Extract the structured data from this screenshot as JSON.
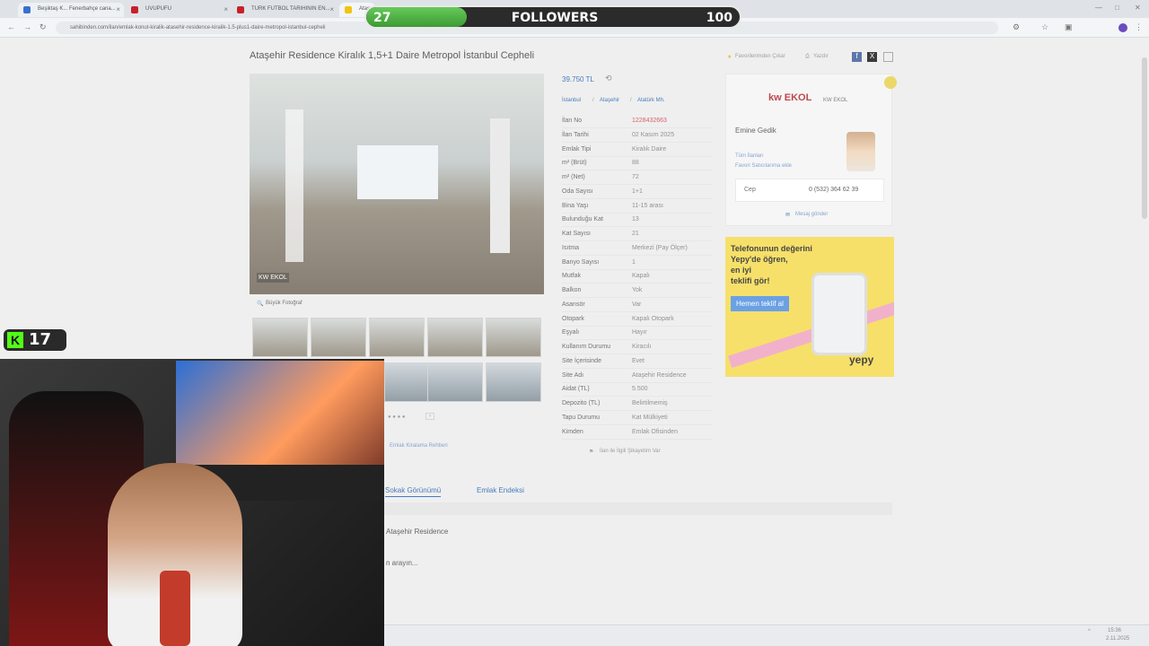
{
  "browser": {
    "tabs": [
      {
        "label": "Beşiktaş K... Fenerbahçe cana...",
        "color": "#3b6fd1"
      },
      {
        "label": "UVUPUFU",
        "color": "#c8202b"
      },
      {
        "label": "TURK FUTBOL TARIHININ EN...",
        "color": "#c8202b"
      },
      {
        "label": "Ataş...",
        "color": "#f1c40f"
      }
    ],
    "url": "sahibinden.com/ilan/emlak-konut-kiralik-atasehir-residence-kiralik-1.5-plus1-daire-metropol-istanbul-cepheli"
  },
  "overlay": {
    "followers_current": "27",
    "followers_label": "FOLLOWERS",
    "followers_goal": "100",
    "followers_progress": 0.27,
    "kick_count": "17"
  },
  "listing": {
    "title": "Ataşehir Residence Kiralık 1,5+1 Daire Metropol İstanbul Cepheli",
    "price": "39.750 TL",
    "location": [
      "İstanbul",
      "Ataşehir",
      "Atatürk Mh."
    ],
    "big_photo": "Büyük Fotoğraf",
    "photo_watermark": "KW EKOL",
    "guide_link": "Emlak Kiralama Rehberi",
    "complaint_link": "İlan ile İlgili Şikayetim Var",
    "details": [
      {
        "k": "İlan No",
        "v": "1228432663"
      },
      {
        "k": "İlan Tarihi",
        "v": "02 Kasım 2025"
      },
      {
        "k": "Emlak Tipi",
        "v": "Kiralık Daire"
      },
      {
        "k": "m² (Brüt)",
        "v": "88"
      },
      {
        "k": "m² (Net)",
        "v": "72"
      },
      {
        "k": "Oda Sayısı",
        "v": "1+1"
      },
      {
        "k": "Bina Yaşı",
        "v": "11-15 arası"
      },
      {
        "k": "Bulunduğu Kat",
        "v": "13"
      },
      {
        "k": "Kat Sayısı",
        "v": "21"
      },
      {
        "k": "Isıtma",
        "v": "Merkezi (Pay Ölçer)"
      },
      {
        "k": "Banyo Sayısı",
        "v": "1"
      },
      {
        "k": "Mutfak",
        "v": "Kapalı"
      },
      {
        "k": "Balkon",
        "v": "Yok"
      },
      {
        "k": "Asansör",
        "v": "Var"
      },
      {
        "k": "Otopark",
        "v": "Kapalı Otopark"
      },
      {
        "k": "Eşyalı",
        "v": "Hayır"
      },
      {
        "k": "Kullanım Durumu",
        "v": "Kiracılı"
      },
      {
        "k": "Site İçerisinde",
        "v": "Evet"
      },
      {
        "k": "Site Adı",
        "v": "Ataşehir Residence"
      },
      {
        "k": "Aidat (TL)",
        "v": "5.500"
      },
      {
        "k": "Depozito (TL)",
        "v": "Belirtilmemiş"
      },
      {
        "k": "Tapu Durumu",
        "v": "Kat Mülkiyeti"
      },
      {
        "k": "Kimden",
        "v": "Emlak Ofisinden"
      }
    ],
    "tabs": [
      "Sokak Görünümü",
      "Emlak Endeksi"
    ],
    "lower_text": "Ataşehir Residence",
    "lower_text2": "n arayın..."
  },
  "top_actions": {
    "favorites": "Favorilerimden Çıkar",
    "print": "Yazdır"
  },
  "agent": {
    "logo": "kw EKOL",
    "office": "KW EKOL",
    "name": "Emine Gedik",
    "all_listings": "Tüm İlanları",
    "add_fav": "Favori Satıcılarıma ekle",
    "phone_label": "Cep",
    "phone": "0 (532) 364 62 39",
    "message": "Mesaj gönder"
  },
  "ad": {
    "headline1": "Telefonunun değerini",
    "headline2": "Yepy'de öğren,",
    "headline3": "en iyi",
    "headline4": "teklifi gör!",
    "cta": "Hemen teklif al",
    "brand": "yepy"
  },
  "taskbar": {
    "time": "15:36",
    "date": "2.11.2025"
  }
}
